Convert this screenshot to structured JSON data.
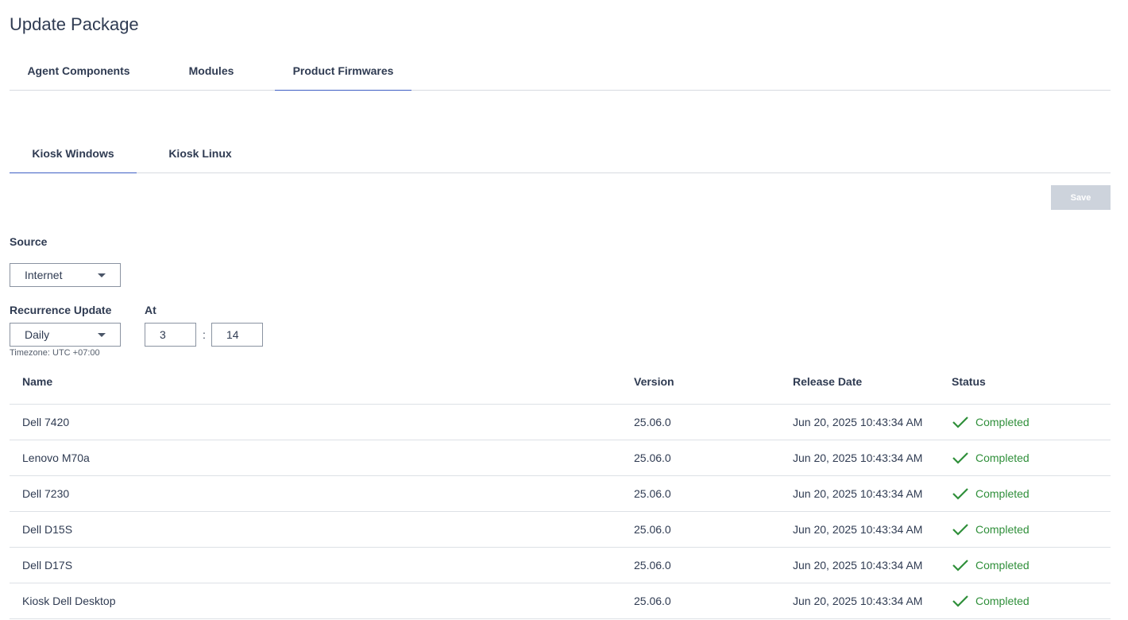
{
  "page": {
    "title": "Update Package"
  },
  "top_tabs": [
    {
      "label": "Agent Components",
      "active": false
    },
    {
      "label": "Modules",
      "active": false
    },
    {
      "label": "Product Firmwares",
      "active": true
    }
  ],
  "sub_tabs": [
    {
      "label": "Kiosk Windows",
      "active": true
    },
    {
      "label": "Kiosk Linux",
      "active": false
    }
  ],
  "toolbar": {
    "save_label": "Save"
  },
  "form": {
    "source_label": "Source",
    "source_value": "Internet",
    "recurrence_label": "Recurrence Update",
    "recurrence_value": "Daily",
    "at_label": "At",
    "hour": "3",
    "minute": "14",
    "separator": ":",
    "timezone": "Timezone: UTC +07:00"
  },
  "table": {
    "headers": {
      "name": "Name",
      "version": "Version",
      "release_date": "Release Date",
      "status": "Status"
    },
    "rows": [
      {
        "name": "Dell 7420",
        "version": "25.06.0",
        "release_date": "Jun 20, 2025 10:43:34 AM",
        "status": "Completed"
      },
      {
        "name": "Lenovo M70a",
        "version": "25.06.0",
        "release_date": "Jun 20, 2025 10:43:34 AM",
        "status": "Completed"
      },
      {
        "name": "Dell 7230",
        "version": "25.06.0",
        "release_date": "Jun 20, 2025 10:43:34 AM",
        "status": "Completed"
      },
      {
        "name": "Dell D15S",
        "version": "25.06.0",
        "release_date": "Jun 20, 2025 10:43:34 AM",
        "status": "Completed"
      },
      {
        "name": "Dell D17S",
        "version": "25.06.0",
        "release_date": "Jun 20, 2025 10:43:34 AM",
        "status": "Completed"
      },
      {
        "name": "Kiosk Dell Desktop",
        "version": "25.06.0",
        "release_date": "Jun 20, 2025 10:43:34 AM",
        "status": "Completed"
      }
    ]
  },
  "colors": {
    "accent": "#3f5fc4",
    "success": "#2f8f3a",
    "disabled_button": "#cdd3dc"
  },
  "icons": {
    "status_completed": "check-icon",
    "select_caret": "caret-down-icon"
  }
}
